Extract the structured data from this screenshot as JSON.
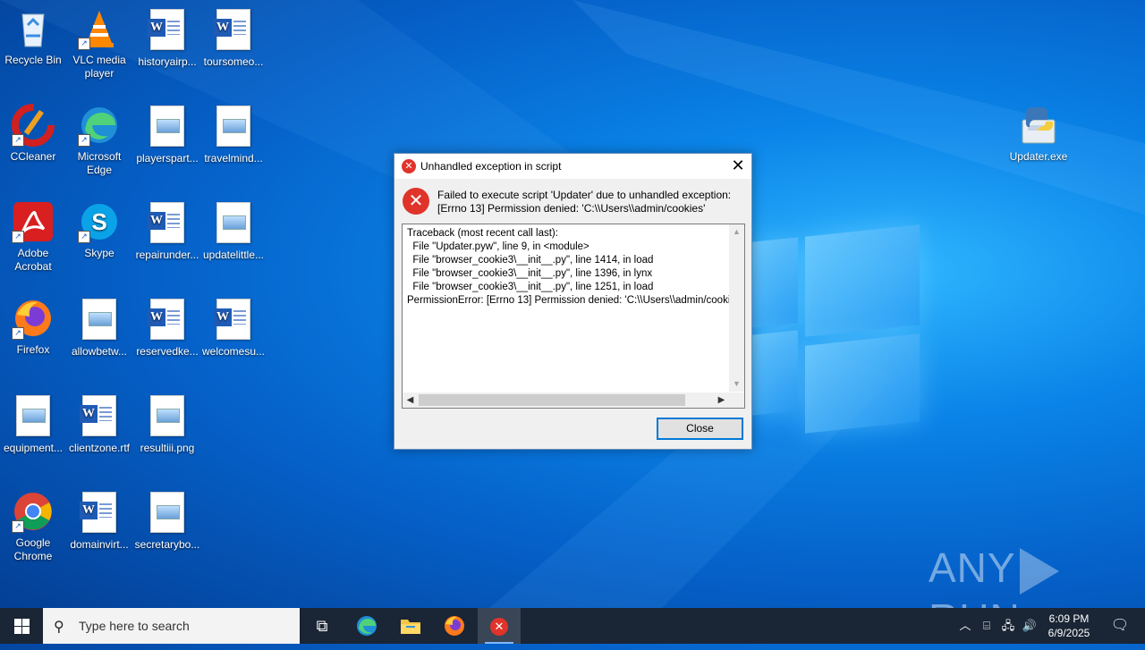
{
  "desktop": {
    "icons": [
      {
        "label": "Recycle Bin"
      },
      {
        "label": "VLC media player"
      },
      {
        "label": "historyairp..."
      },
      {
        "label": "toursomeo..."
      },
      {
        "label": "CCleaner"
      },
      {
        "label": "Microsoft Edge"
      },
      {
        "label": "playerspart..."
      },
      {
        "label": "travelmind..."
      },
      {
        "label": "Adobe Acrobat"
      },
      {
        "label": "Skype"
      },
      {
        "label": "repairunder..."
      },
      {
        "label": "updatelittle..."
      },
      {
        "label": "Firefox"
      },
      {
        "label": "allowbetw..."
      },
      {
        "label": "reservedke..."
      },
      {
        "label": "welcomesu..."
      },
      {
        "label": "equipment..."
      },
      {
        "label": "clientzone.rtf"
      },
      {
        "label": "resultiii.png"
      },
      {
        "label": "Google Chrome"
      },
      {
        "label": "domainvirt..."
      },
      {
        "label": "secretarybo..."
      },
      {
        "label": "Updater.exe"
      }
    ]
  },
  "dialog": {
    "title": "Unhandled exception in script",
    "message_line1": "Failed to execute script 'Updater' due to unhandled exception:",
    "message_line2": "[Errno 13] Permission denied: 'C:\\\\Users\\\\admin/cookies'",
    "traceback": "Traceback (most recent call last):\n  File \"Updater.pyw\", line 9, in <module>\n  File \"browser_cookie3\\__init__.py\", line 1414, in load\n  File \"browser_cookie3\\__init__.py\", line 1396, in lynx\n  File \"browser_cookie3\\__init__.py\", line 1251, in load\nPermissionError: [Errno 13] Permission denied: 'C:\\\\Users\\\\admin/cookies'",
    "close_button": "Close"
  },
  "watermark": {
    "left": "ANY",
    "right": "RUN"
  },
  "taskbar": {
    "search_placeholder": "Type here to search",
    "time": "6:09 PM",
    "date": "6/9/2025"
  },
  "colors": {
    "accent": "#0078d7",
    "error": "#e0342b",
    "taskbar": "#1a2535"
  }
}
